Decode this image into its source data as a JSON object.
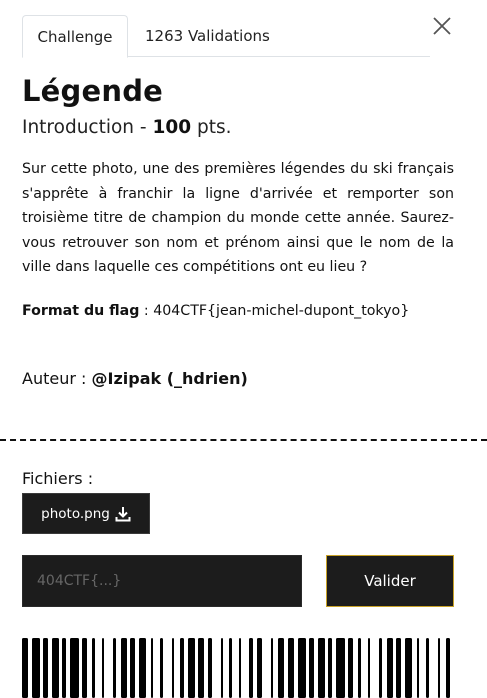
{
  "tabs": [
    {
      "label": "Challenge",
      "active": true
    },
    {
      "label": "1263 Validations",
      "active": false
    }
  ],
  "challenge": {
    "name": "Légende",
    "category": "Introduction",
    "separator": " - ",
    "points": "100",
    "points_suffix": " pts.",
    "description": "Sur cette photo, une des premières légendes du ski français s'apprête à franchir la ligne d'arrivée et remporter son troisième titre de champion du monde cette année. Saurez-vous retrouver son nom et prénom ainsi que le nom de la ville dans laquelle ces compétitions ont eu lieu ?",
    "flag_format_label": "Format du flag",
    "flag_format_sep": " : ",
    "flag_format_value": "404CTF{jean-michel-dupont_tokyo}",
    "author_label": "Auteur : ",
    "author_name": "@Izipak (_hdrien)"
  },
  "files": {
    "label": "Fichiers :",
    "items": [
      {
        "name": "photo.png",
        "icon": "download-icon"
      }
    ]
  },
  "submission": {
    "placeholder": "404CTF{...}",
    "value": "",
    "submit_label": "Valider",
    "accent_color": "#c9a227"
  },
  "icons": {
    "close": "close-icon",
    "download": "download-icon"
  },
  "colors": {
    "dark_bg": "#1c1c1c",
    "text": "#111111",
    "tab_border": "#dee2e6"
  }
}
